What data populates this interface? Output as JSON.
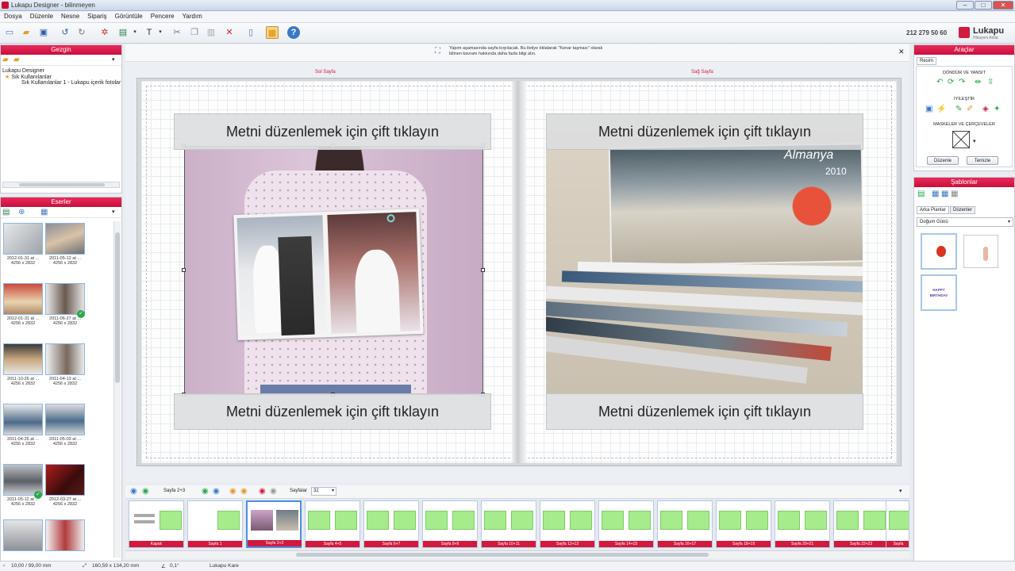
{
  "window": {
    "title": "Lukapu Designer - bilinmeyen"
  },
  "menu": [
    "Dosya",
    "Düzenle",
    "Nesne",
    "Sipariş",
    "Görüntüle",
    "Pencere",
    "Yardım"
  ],
  "header": {
    "phone": "212 279 50 60",
    "logo_name": "Lukapu",
    "logo_sub": "Hikayeni Anlat"
  },
  "left_top": {
    "title": "Gezgin",
    "tree": [
      "Lukapu Designer",
      "Sık Kullanılanlar",
      "Sık Kullanılanlar 1 - Lukapu içerik fotolar"
    ]
  },
  "left_bottom": {
    "title": "Eserler",
    "thumbs": [
      {
        "c1": "2012-01-31 at ...",
        "c2": "4256 x 2832"
      },
      {
        "c1": "2011-05-12 at ...",
        "c2": "4256 x 2832"
      },
      {
        "c1": "2012-01-31 at ...",
        "c2": "4256 x 2832"
      },
      {
        "c1": "2011-06-27 at ...",
        "c2": "4256 x 2832"
      },
      {
        "c1": "2011-10-26 at ...",
        "c2": "4256 x 2832"
      },
      {
        "c1": "2011-04-13 at ...",
        "c2": "4256 x 2832"
      },
      {
        "c1": "2011-04-26 at ...",
        "c2": "4256 x 2832"
      },
      {
        "c1": "2011-05-03 at ...",
        "c2": "4256 x 2832"
      },
      {
        "c1": "2011-05-12 at ...",
        "c2": "4256 x 2832"
      },
      {
        "c1": "2012-03-27 at ...",
        "c2": "4256 x 2832"
      }
    ]
  },
  "info_message": "Yapım aşamasında sayfa kırpılacak. Bu iletiye tıklatarak \"Kenar taşması\" olarak bilinen kavram hakkında daha fazla bilgi alın.",
  "canvas": {
    "left_label": "Sol Sayfa",
    "right_label": "Sağ Sayfa",
    "text_placeholder": "Metni düzenlemek için çift tıklayın",
    "album_text": "Almanya",
    "album_year": "2010"
  },
  "right_top": {
    "title": "Araçlar",
    "tab": "Resim",
    "section1": "DÖNDÜR VE YANSIT",
    "section2": "İYİLEŞTİR",
    "section3": "MASKELER VE ÇERÇEVELER",
    "btn_edit": "Düzenle",
    "btn_clear": "Temizle"
  },
  "right_bottom": {
    "title": "Şablonlar",
    "tab1": "Arka Planlar",
    "tab2": "Düzenler",
    "dropdown": "Doğum Günü",
    "sticker_text": "HAPPY BIRTHDAY"
  },
  "filmbar": {
    "page_info": "Sayfa 2+3",
    "pages_label": "Sayfalar",
    "pages_count": "32"
  },
  "filmstrip": [
    "Kapak",
    "Sayfa 1",
    "Sayfa 2+3",
    "Sayfa 4+5",
    "Sayfa 6+7",
    "Sayfa 8+9",
    "Sayfa 10+11",
    "Sayfa 12+13",
    "Sayfa 14+15",
    "Sayfa 16+17",
    "Sayfa 18+19",
    "Sayfa 20+21",
    "Sayfa 22+23",
    "Sayfa"
  ],
  "status": {
    "s1": "10,00 / 99,00 mm",
    "s2": "160,59 x 134,20 mm",
    "s3": "0,1°",
    "s4": "Lukapu Kare"
  },
  "colors": {
    "accent": "#d3193d",
    "placeholder_green": "#a6ec8c"
  }
}
